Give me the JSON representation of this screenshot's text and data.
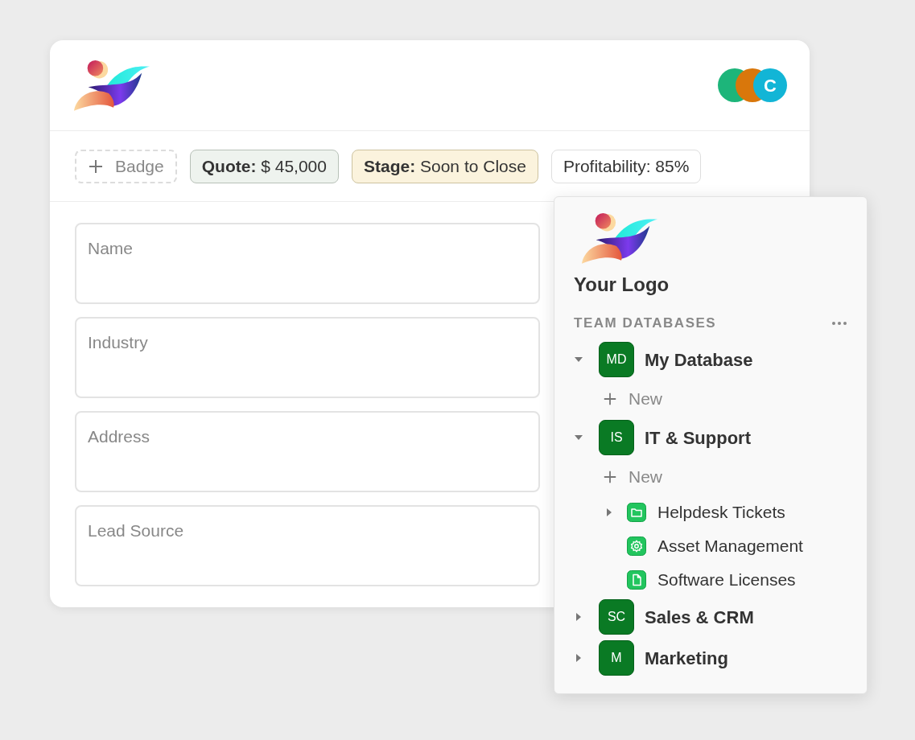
{
  "header": {
    "avatars": [
      {
        "color": "#1db57a"
      },
      {
        "color": "#d9770b"
      },
      {
        "initial": "C",
        "color": "#12b5d6"
      }
    ]
  },
  "badges": [
    {
      "kind": "add",
      "text": "Badge"
    },
    {
      "kind": "green",
      "text": "**Quote:** $ 45,000"
    },
    {
      "kind": "yellow",
      "text": "**Stage:** Soon to Close"
    },
    {
      "kind": "plain",
      "text": "Profitability: 85%"
    }
  ],
  "fields": [
    {
      "placeholder": "Name"
    },
    {
      "placeholder": "Industry"
    },
    {
      "placeholder": "Address"
    },
    {
      "placeholder": "Lead Source"
    }
  ],
  "panel": {
    "logo_text": "Your Logo",
    "section_title": "TEAM DATABASES",
    "databases": [
      {
        "initials": "MD",
        "name": "My Database",
        "expanded": true,
        "children": [
          {
            "kind": "new",
            "label": "New"
          }
        ]
      },
      {
        "initials": "IS",
        "name": "IT & Support",
        "expanded": true,
        "children": [
          {
            "kind": "new",
            "label": "New"
          },
          {
            "kind": "folder",
            "label": "Helpdesk Tickets",
            "expanded": false
          },
          {
            "kind": "settings",
            "label": "Asset Management"
          },
          {
            "kind": "file",
            "label": "Software Licenses"
          }
        ]
      },
      {
        "initials": "SC",
        "name": "Sales & CRM",
        "expanded": false
      },
      {
        "initials": "M",
        "name": "Marketing",
        "expanded": false
      }
    ]
  }
}
